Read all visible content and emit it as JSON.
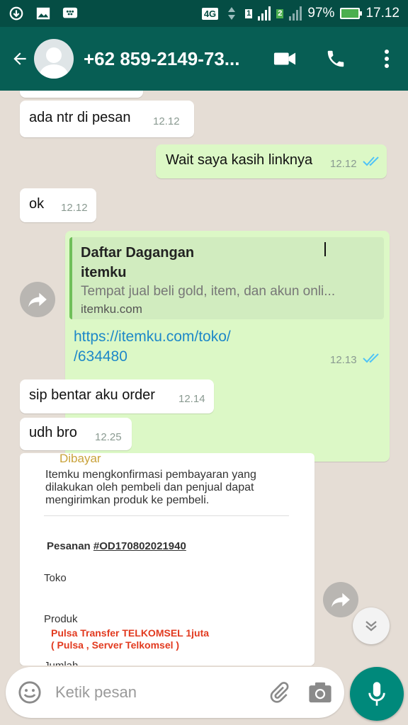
{
  "status_bar": {
    "network": "4G",
    "sim1": "1",
    "sim2": "2",
    "battery": "97%",
    "time": "17.12"
  },
  "header": {
    "contact_name": "+62 859-2149-73..."
  },
  "messages": [
    {
      "direction": "in",
      "text": "ada ntr di pesan",
      "time": "12.12"
    },
    {
      "direction": "out",
      "text": "Wait saya kasih linknya",
      "time": "12.12",
      "ticks": "read"
    },
    {
      "direction": "in",
      "text": "ok",
      "time": "12.12"
    },
    {
      "direction": "out",
      "preview": {
        "title_line1": "Daftar Dagangan",
        "title_line2": "itemku",
        "description": "Tempat jual beli gold, item, dan akun onli...",
        "domain": "itemku.com"
      },
      "link_line1": "https://itemku.com/toko/",
      "link_line2": "/634480",
      "time": "12.13",
      "ticks": "read"
    },
    {
      "direction": "in",
      "text": "sip bentar aku order",
      "time": "12.14"
    },
    {
      "direction": "in",
      "text": "udh bro",
      "time": "12.25"
    }
  ],
  "image_card": {
    "heading_partial": "Dibayar",
    "paragraph": "Itemku mengkonfirmasi pembayaran yang dilakukan oleh pembeli dan penjual dapat mengirimkan produk ke pembeli.",
    "pesanan_label": "Pesanan",
    "pesanan_id": "#OD170802021940",
    "toko_label": "Toko",
    "produk_label": "Produk",
    "produk_line1": "Pulsa Transfer TELKOMSEL 1juta",
    "produk_line2": "( Pulsa , Server Telkomsel )",
    "jumlah_label": "Jumlah"
  },
  "composer": {
    "placeholder": "Ketik pesan"
  },
  "colors": {
    "header": "#075e54",
    "status_bar": "#054d44",
    "outgoing_bubble": "#dcf8c6",
    "read_ticks": "#4fc3f7",
    "mic_button": "#00897b"
  }
}
